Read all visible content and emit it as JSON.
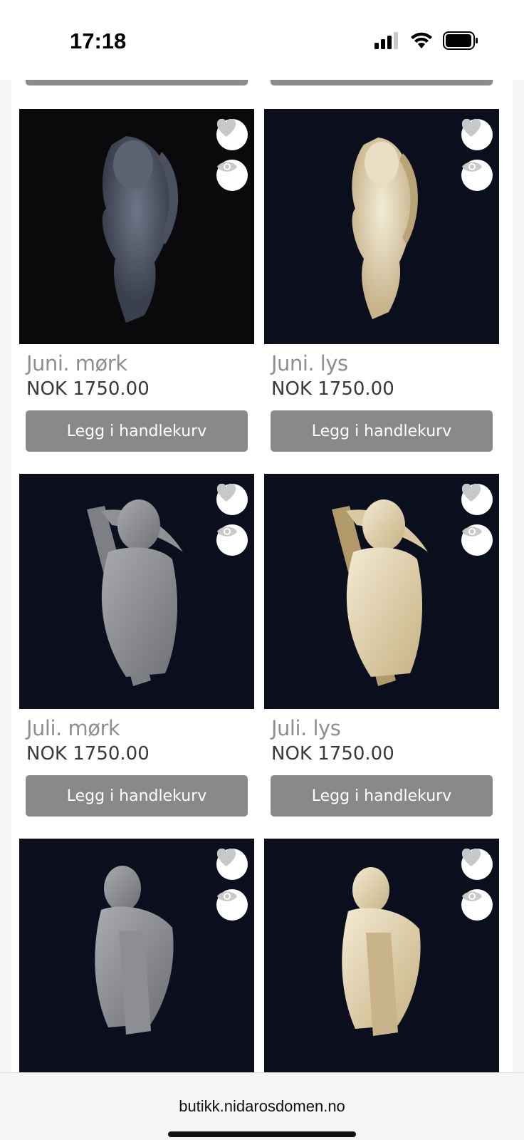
{
  "status_bar": {
    "time": "17:18"
  },
  "products": [
    {
      "name": "Juni. mørk",
      "price": "NOK 1750.00",
      "button_label": "Legg i handlekurv",
      "image": "angel-figurine-dark"
    },
    {
      "name": "Juni. lys",
      "price": "NOK 1750.00",
      "button_label": "Legg i handlekurv",
      "image": "angel-figurine-light"
    },
    {
      "name": "Juli. mørk",
      "price": "NOK 1750.00",
      "button_label": "Legg i handlekurv",
      "image": "scythe-figurine-dark"
    },
    {
      "name": "Juli. lys",
      "price": "NOK 1750.00",
      "button_label": "Legg i handlekurv",
      "image": "scythe-figurine-light"
    },
    {
      "image": "sheaf-figurine-dark"
    },
    {
      "image": "sheaf-figurine-light"
    }
  ],
  "icons": {
    "favorite": "heart-icon",
    "quick_view": "eye-icon"
  },
  "colors": {
    "button": "#88898b",
    "image_bg": "#0b0e1c",
    "name_text": "#8f8f92",
    "price_text": "#3a3a3d"
  },
  "browser": {
    "url": "butikk.nidarosdomen.no"
  }
}
